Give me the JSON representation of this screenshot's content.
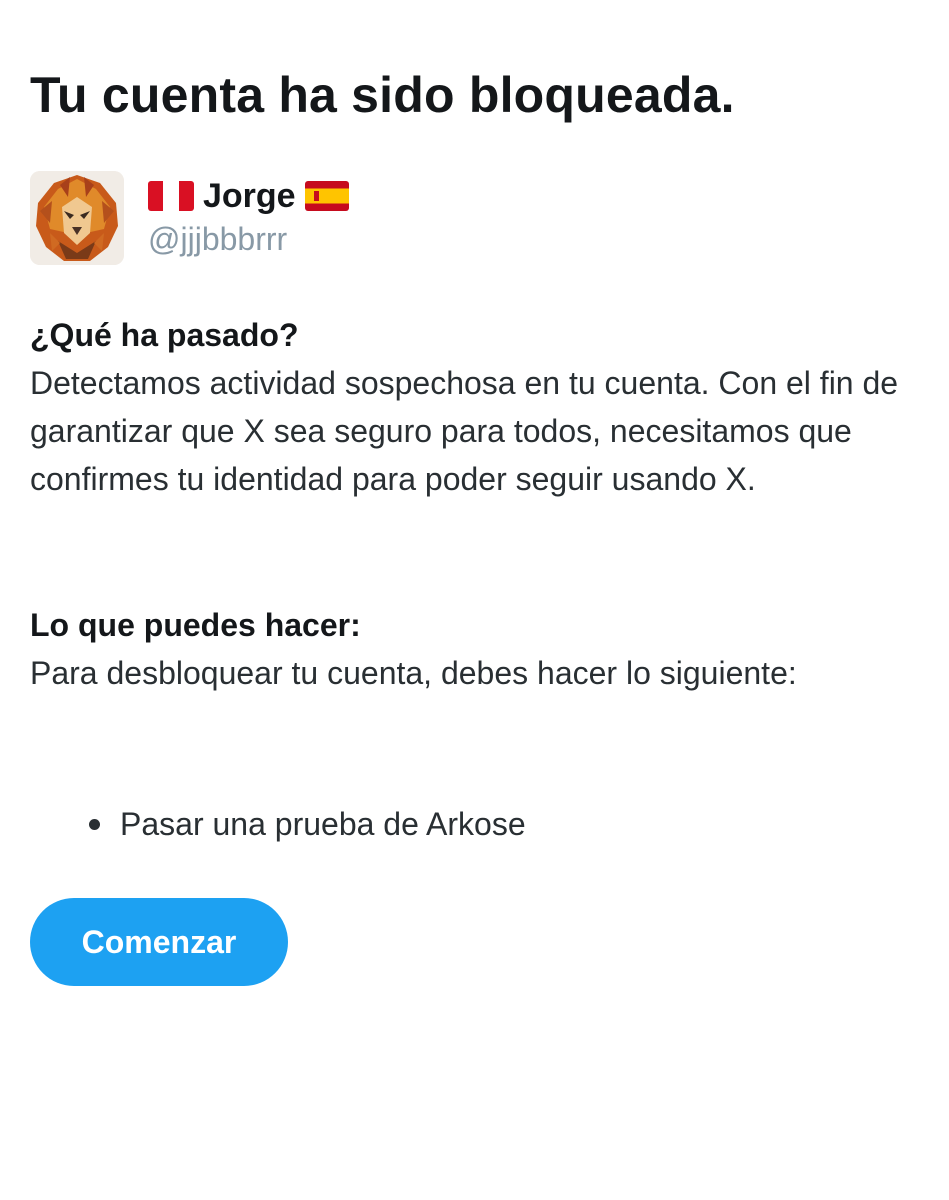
{
  "page": {
    "title": "Tu cuenta ha sido bloqueada."
  },
  "account": {
    "display_name": "Jorge",
    "handle": "@jjjbbbrrr",
    "avatar": "lion-portrait",
    "flag_left": "peru-flag-icon",
    "flag_right": "spain-flag-icon"
  },
  "what_happened": {
    "heading": "¿Qué ha pasado?",
    "body": "Detectamos actividad sospechosa en tu cuenta. Con el fin de garantizar que X sea seguro para todos, necesitamos que confirmes tu identidad para poder seguir usando X."
  },
  "what_to_do": {
    "heading": "Lo que puedes hacer:",
    "body": "Para desbloquear tu cuenta, debes hacer lo siguiente:",
    "steps": [
      "Pasar una prueba de Arkose"
    ]
  },
  "actions": {
    "start_label": "Comenzar"
  },
  "colors": {
    "accent": "#1da1f2",
    "text": "#14171a",
    "secondary_text": "#8899a6"
  }
}
